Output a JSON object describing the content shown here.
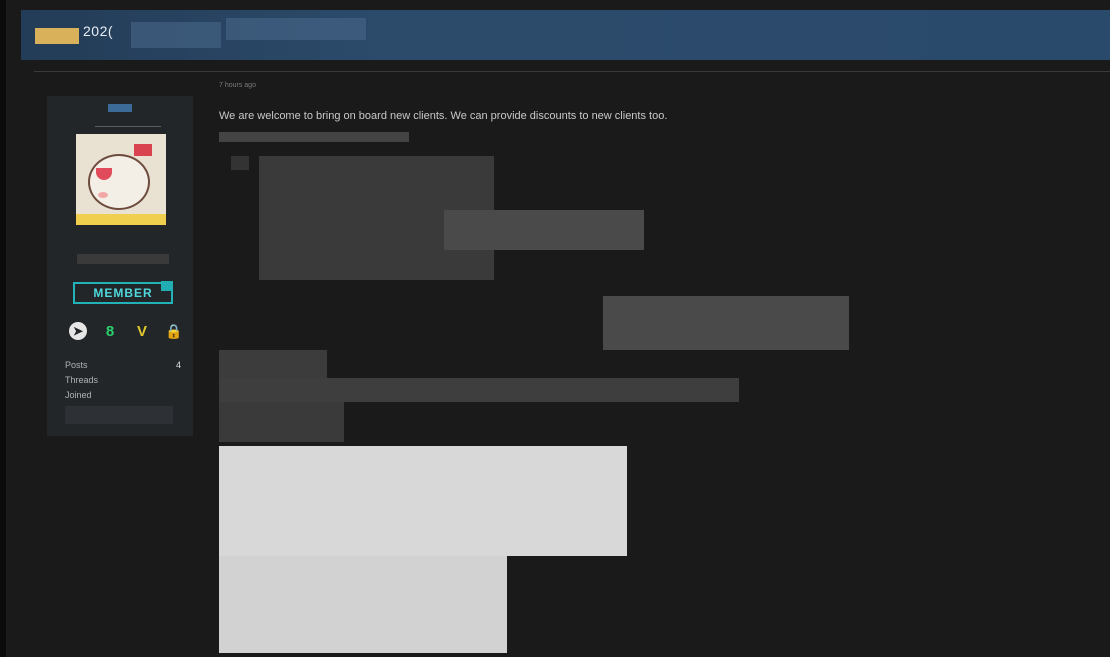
{
  "thread": {
    "title_visible": "202("
  },
  "post": {
    "time_label": "7 hours ago",
    "body_text": "We are welcome to bring on board new clients. We can provide discounts to new clients too."
  },
  "author": {
    "role_badge": "MEMBER",
    "contact_icons": [
      "telegram-icon",
      "session-icon",
      "v-icon",
      "lock-icon"
    ],
    "stats": [
      {
        "label": "Posts",
        "value": "4"
      },
      {
        "label": "Threads",
        "value": ""
      },
      {
        "label": "Joined",
        "value": ""
      }
    ]
  },
  "colors": {
    "title_bar": "#2a4a6c",
    "badge_accent": "#21b3b8",
    "background": "#1a1a1a"
  }
}
